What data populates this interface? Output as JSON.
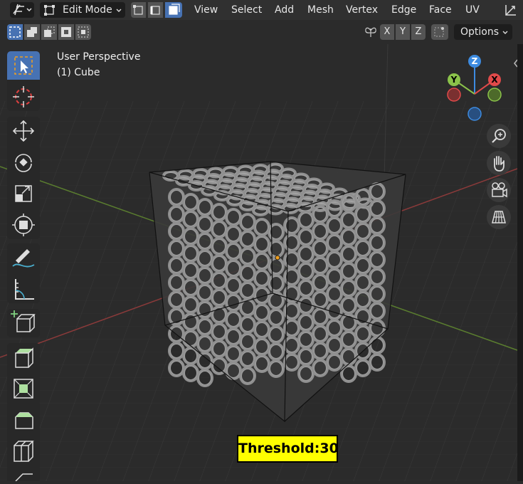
{
  "header": {
    "mode_label": "Edit Mode",
    "menus": [
      "View",
      "Select",
      "Add",
      "Mesh",
      "Vertex",
      "Edge",
      "Face",
      "UV"
    ]
  },
  "subheader": {
    "mirror_axes": [
      "X",
      "Y",
      "Z"
    ],
    "options_label": "Options"
  },
  "viewport": {
    "view_name": "User Perspective",
    "object_name": "(1) Cube",
    "gizmo": {
      "x": "X",
      "y": "Y",
      "z": "Z"
    }
  },
  "overlay": {
    "threshold_text": "Threshold:30"
  },
  "colors": {
    "accent": "#4772b3",
    "axis_x": "#e14a4a",
    "axis_y": "#8bc34a",
    "axis_z": "#3d8be0",
    "threshold_bg": "#ffff00"
  }
}
